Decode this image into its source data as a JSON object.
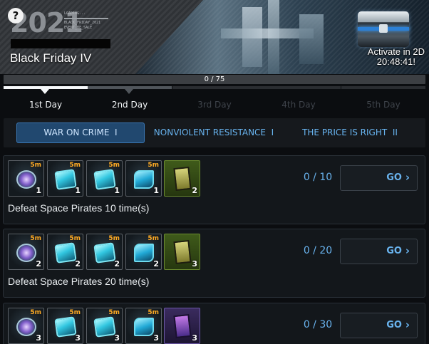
{
  "banner": {
    "year": "2021",
    "year_lines": [
      "LOADING...",
      "BLACK_FRIDAY_2021",
      "EVENT_BE_SALE"
    ],
    "title": "Black Friday IV",
    "activate_line1": "Activate in 2D",
    "activate_line2": "20:48:41!",
    "help_icon": "question-icon"
  },
  "progress": {
    "text": "0 / 75",
    "value": 0,
    "max": 75,
    "fill_color": "#5aa7e8"
  },
  "days": [
    {
      "label": "1st Day",
      "state": "active"
    },
    {
      "label": "2nd Day",
      "state": "done"
    },
    {
      "label": "3rd Day",
      "state": "locked"
    },
    {
      "label": "4th Day",
      "state": "locked"
    },
    {
      "label": "5th Day",
      "state": "locked"
    }
  ],
  "categories": [
    {
      "label": "WAR ON CRIME  I",
      "active": true
    },
    {
      "label": "NONVIOLENT RESISTANCE  I",
      "active": false
    },
    {
      "label": "THE PRICE IS RIGHT  II",
      "active": false
    }
  ],
  "missions": [
    {
      "rewards": [
        {
          "icon": "purple-orb-icon",
          "duration": "5m",
          "qty": "1"
        },
        {
          "icon": "cyan-crystal-icon",
          "duration": "5m",
          "qty": "1"
        },
        {
          "icon": "cyan-cube-icon",
          "duration": "5m",
          "qty": "1"
        },
        {
          "icon": "blue-crystal-icon",
          "duration": "5m",
          "qty": "1"
        },
        {
          "icon": "green-card-icon",
          "duration": "",
          "qty": "2"
        }
      ],
      "count": "0 / 10",
      "go_label": "GO",
      "description": "Defeat Space Pirates 10 time(s)"
    },
    {
      "rewards": [
        {
          "icon": "purple-orb-icon",
          "duration": "5m",
          "qty": "2"
        },
        {
          "icon": "cyan-crystal-icon",
          "duration": "5m",
          "qty": "2"
        },
        {
          "icon": "cyan-cube-icon",
          "duration": "5m",
          "qty": "2"
        },
        {
          "icon": "blue-crystal-icon",
          "duration": "5m",
          "qty": "2"
        },
        {
          "icon": "green-card-icon",
          "duration": "",
          "qty": "3"
        }
      ],
      "count": "0 / 20",
      "go_label": "GO",
      "description": "Defeat Space Pirates 20 time(s)"
    },
    {
      "rewards": [
        {
          "icon": "purple-orb-icon",
          "duration": "5m",
          "qty": "3"
        },
        {
          "icon": "cyan-crystal-icon",
          "duration": "5m",
          "qty": "3"
        },
        {
          "icon": "cyan-cube-icon",
          "duration": "5m",
          "qty": "3"
        },
        {
          "icon": "blue-crystal-icon",
          "duration": "5m",
          "qty": "3"
        },
        {
          "icon": "purple-card-icon",
          "duration": "",
          "qty": "3"
        }
      ],
      "count": "0 / 30",
      "go_label": "GO"
    }
  ]
}
